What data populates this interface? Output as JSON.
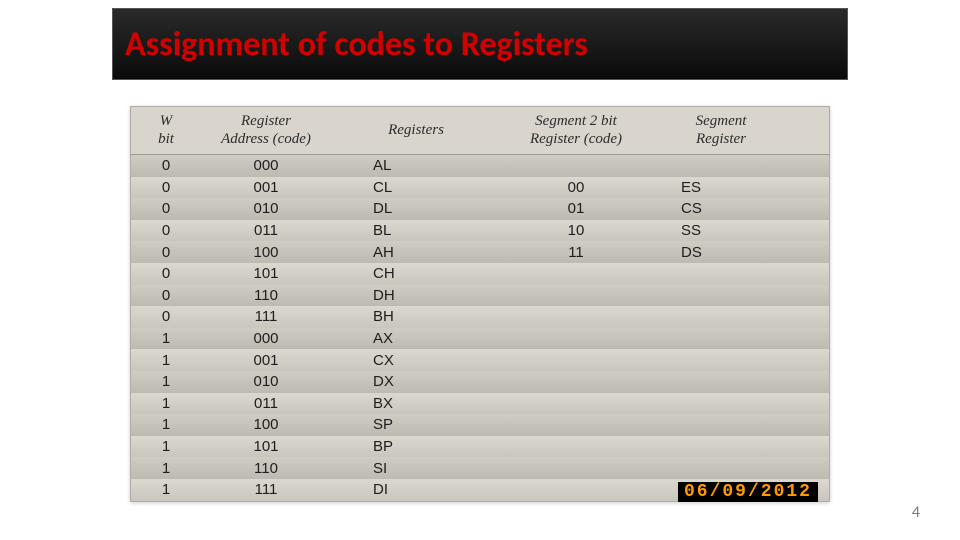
{
  "title": "Assignment of codes to Registers",
  "page_number": "4",
  "datestamp_partial": "06/09/2012",
  "columns": {
    "c1a": "W",
    "c1b": "bit",
    "c2a": "Register",
    "c2b": "Address (code)",
    "c3a": "Registers",
    "c4a": "Segment 2 bit",
    "c4b": "Register (code)",
    "c5a": "Segment",
    "c5b": "Register"
  },
  "chart_data": {
    "type": "table",
    "columns": [
      "W bit",
      "Register Address (code)",
      "Registers",
      "Segment 2 bit Register (code)",
      "Segment Register"
    ],
    "rows": [
      {
        "w": "0",
        "addr": "000",
        "reg": "AL",
        "seg_code": "",
        "seg_reg": ""
      },
      {
        "w": "0",
        "addr": "001",
        "reg": "CL",
        "seg_code": "00",
        "seg_reg": "ES"
      },
      {
        "w": "0",
        "addr": "010",
        "reg": "DL",
        "seg_code": "01",
        "seg_reg": "CS"
      },
      {
        "w": "0",
        "addr": "011",
        "reg": "BL",
        "seg_code": "10",
        "seg_reg": "SS"
      },
      {
        "w": "0",
        "addr": "100",
        "reg": "AH",
        "seg_code": "11",
        "seg_reg": "DS"
      },
      {
        "w": "0",
        "addr": "101",
        "reg": "CH",
        "seg_code": "",
        "seg_reg": ""
      },
      {
        "w": "0",
        "addr": "110",
        "reg": "DH",
        "seg_code": "",
        "seg_reg": ""
      },
      {
        "w": "0",
        "addr": "111",
        "reg": "BH",
        "seg_code": "",
        "seg_reg": ""
      },
      {
        "w": "1",
        "addr": "000",
        "reg": "AX",
        "seg_code": "",
        "seg_reg": ""
      },
      {
        "w": "1",
        "addr": "001",
        "reg": "CX",
        "seg_code": "",
        "seg_reg": ""
      },
      {
        "w": "1",
        "addr": "010",
        "reg": "DX",
        "seg_code": "",
        "seg_reg": ""
      },
      {
        "w": "1",
        "addr": "011",
        "reg": "BX",
        "seg_code": "",
        "seg_reg": ""
      },
      {
        "w": "1",
        "addr": "100",
        "reg": "SP",
        "seg_code": "",
        "seg_reg": ""
      },
      {
        "w": "1",
        "addr": "101",
        "reg": "BP",
        "seg_code": "",
        "seg_reg": ""
      },
      {
        "w": "1",
        "addr": "110",
        "reg": "SI",
        "seg_code": "",
        "seg_reg": ""
      },
      {
        "w": "1",
        "addr": "111",
        "reg": "DI",
        "seg_code": "",
        "seg_reg": ""
      }
    ]
  }
}
